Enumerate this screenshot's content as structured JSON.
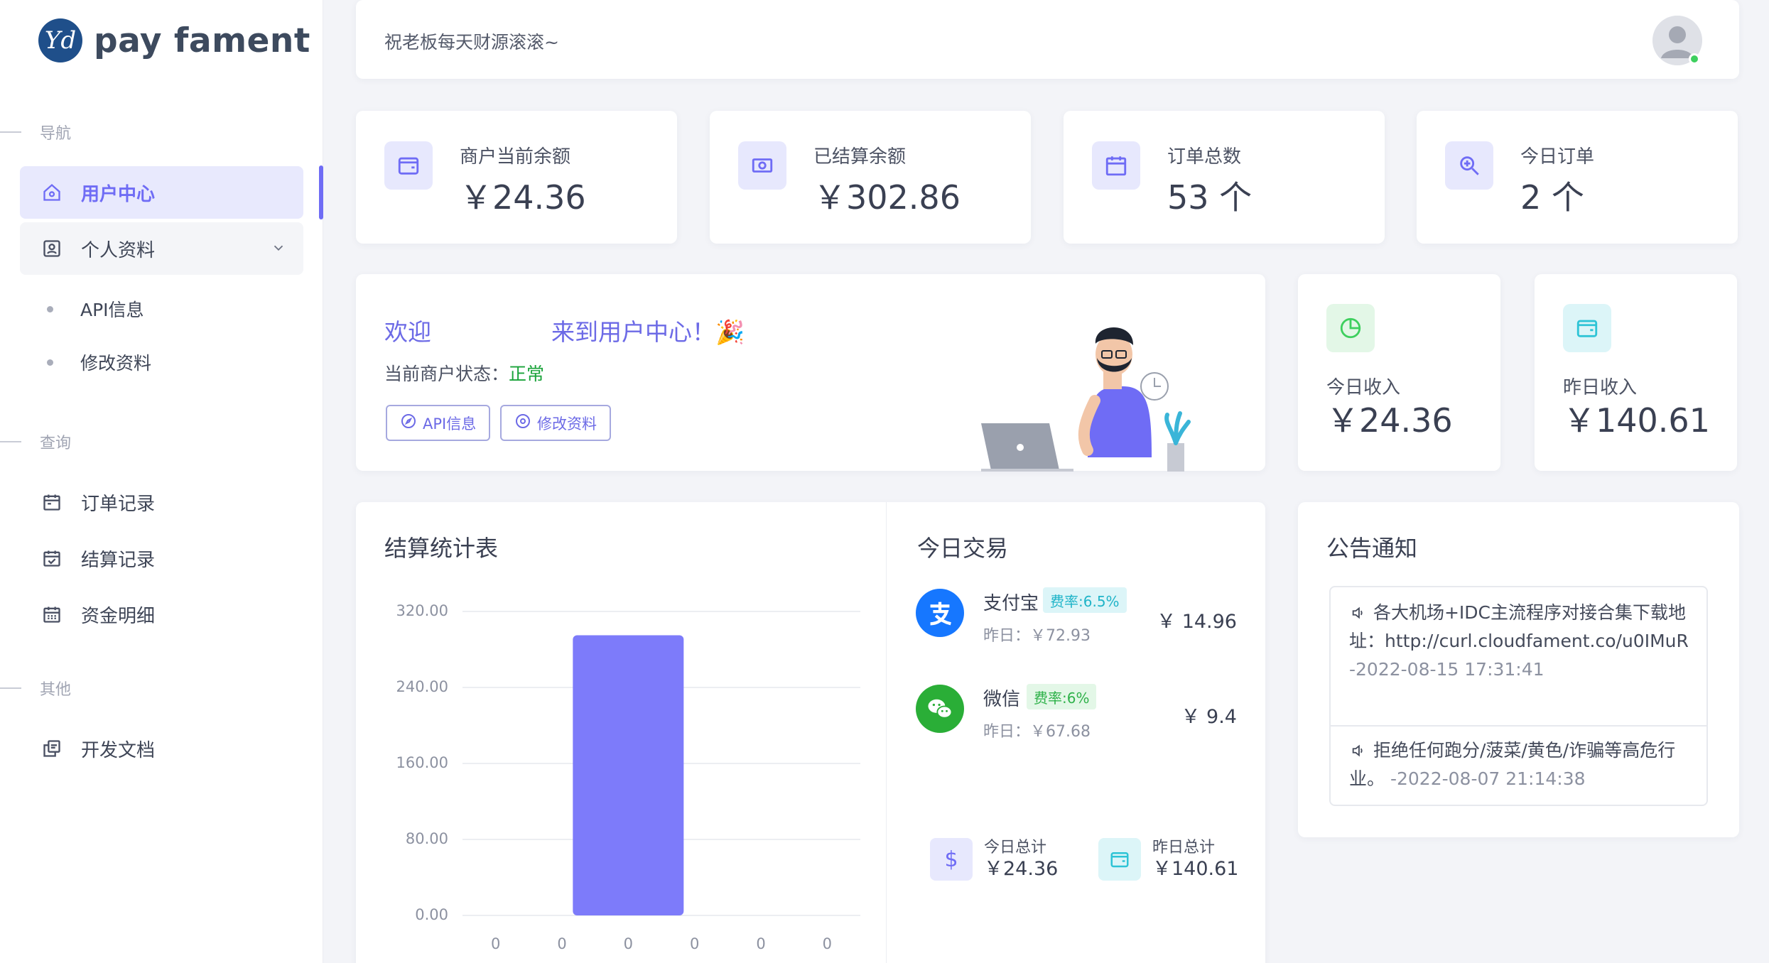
{
  "brand": {
    "logo_mark": "Yd",
    "name": "pay fament"
  },
  "sidebar": {
    "sections": {
      "nav": "导航",
      "query": "查询",
      "other": "其他"
    },
    "items": {
      "user_center": "用户中心",
      "profile": "个人资料",
      "api_info": "API信息",
      "edit_profile": "修改资料",
      "order_records": "订单记录",
      "settle_records": "结算记录",
      "fund_details": "资金明细",
      "dev_docs": "开发文档"
    }
  },
  "header": {
    "greeting": "祝老板每天财源滚滚~"
  },
  "stats": [
    {
      "label": "商户当前余额",
      "value": "￥24.36",
      "icon": "wallet-icon",
      "color": "#6f6cf5"
    },
    {
      "label": "已结算余额",
      "value": "￥302.86",
      "icon": "money-icon",
      "color": "#6f6cf5"
    },
    {
      "label": "订单总数",
      "value": "53 个",
      "icon": "calendar-icon",
      "color": "#6f6cf5"
    },
    {
      "label": "今日订单",
      "value": "2 个",
      "icon": "zoom-in-icon",
      "color": "#6f6cf5"
    }
  ],
  "welcome": {
    "title_left": "欢迎",
    "title_right": "来到用户中心！🎉",
    "status_label": "当前商户状态：",
    "status_value": "正常",
    "btn_api": "API信息",
    "btn_edit": "修改资料"
  },
  "income": {
    "today": {
      "label": "今日收入",
      "value": "￥24.36",
      "icon": "pie-chart-icon",
      "color": "#3ecf5e"
    },
    "yesterday": {
      "label": "昨日收入",
      "value": "￥140.61",
      "icon": "wallet-icon",
      "color": "#2ec4d6"
    }
  },
  "settlement": {
    "title": "结算统计表"
  },
  "chart_data": {
    "type": "bar",
    "categories": [
      "0",
      "0",
      "0",
      "0",
      "0",
      "0"
    ],
    "values": [
      0,
      0,
      295,
      0,
      0,
      0
    ],
    "title": "结算统计表",
    "xlabel": "",
    "ylabel": "",
    "ylim": [
      0,
      320
    ],
    "yticks": [
      "320.00",
      "240.00",
      "160.00",
      "80.00",
      "0.00"
    ],
    "grid": true,
    "bar_color": "#7d7bfa"
  },
  "today_trade": {
    "title": "今日交易",
    "alipay": {
      "name": "支付宝",
      "rate": "费率:6.5%",
      "yesterday": "昨日：￥72.93",
      "amount": "￥ 14.96"
    },
    "wechat": {
      "name": "微信",
      "rate": "费率:6%",
      "yesterday": "昨日：￥67.68",
      "amount": "￥ 9.4"
    },
    "today_total": {
      "label": "今日总计",
      "value": "￥24.36"
    },
    "yesterday_total": {
      "label": "昨日总计",
      "value": "￥140.61"
    }
  },
  "notice": {
    "title": "公告通知",
    "items": [
      {
        "text": "各大机场+IDC主流程序对接合集下载地址：http://curl.cloudfament.co/u0IMuR",
        "time": "-2022-08-15 17:31:41"
      },
      {
        "text": "拒绝任何跑分/菠菜/黄色/诈骗等高危行业。",
        "time": "-2022-08-07 21:14:38"
      }
    ]
  }
}
